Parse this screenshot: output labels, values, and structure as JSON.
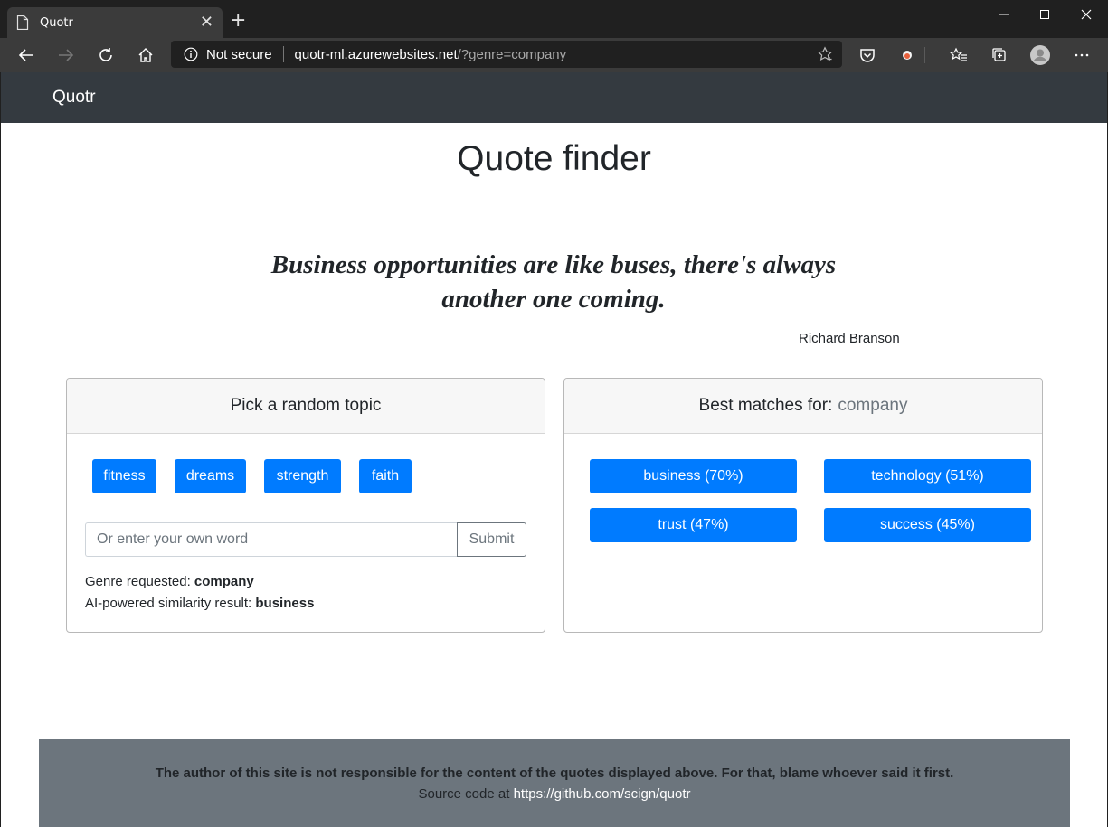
{
  "browser": {
    "tab_title": "Quotr",
    "tab_icon": "document-icon",
    "security_label": "Not secure",
    "url_host": "quotr-ml.azurewebsites.net",
    "url_path": "/?genre=company"
  },
  "navbar": {
    "brand": "Quotr"
  },
  "page": {
    "title": "Quote finder",
    "quote_text": "Business opportunities are like buses, there's always another one coming.",
    "quote_author": "Richard Branson"
  },
  "random_topic_card": {
    "header": "Pick a random topic",
    "topics": [
      "fitness",
      "dreams",
      "strength",
      "faith"
    ],
    "input_placeholder": "Or enter your own word",
    "submit_label": "Submit",
    "genre_label": "Genre requested: ",
    "genre_value": "company",
    "similarity_label": "AI-powered similarity result: ",
    "similarity_value": "business"
  },
  "best_matches_card": {
    "header_label": "Best matches for:",
    "header_term": "company",
    "matches": [
      "business (70%)",
      "technology (51%)",
      "trust (47%)",
      "success (45%)"
    ]
  },
  "footer": {
    "disclaimer": "The author of this site is not responsible for the content of the quotes displayed above. For that, blame whoever said it first.",
    "source_prefix": "Source code at ",
    "source_link": "https://github.com/scign/quotr"
  },
  "colors": {
    "primary": "#007bff",
    "navbar": "#343a40",
    "footer": "#6c757d",
    "browser_chrome": "#3b3b3b"
  }
}
